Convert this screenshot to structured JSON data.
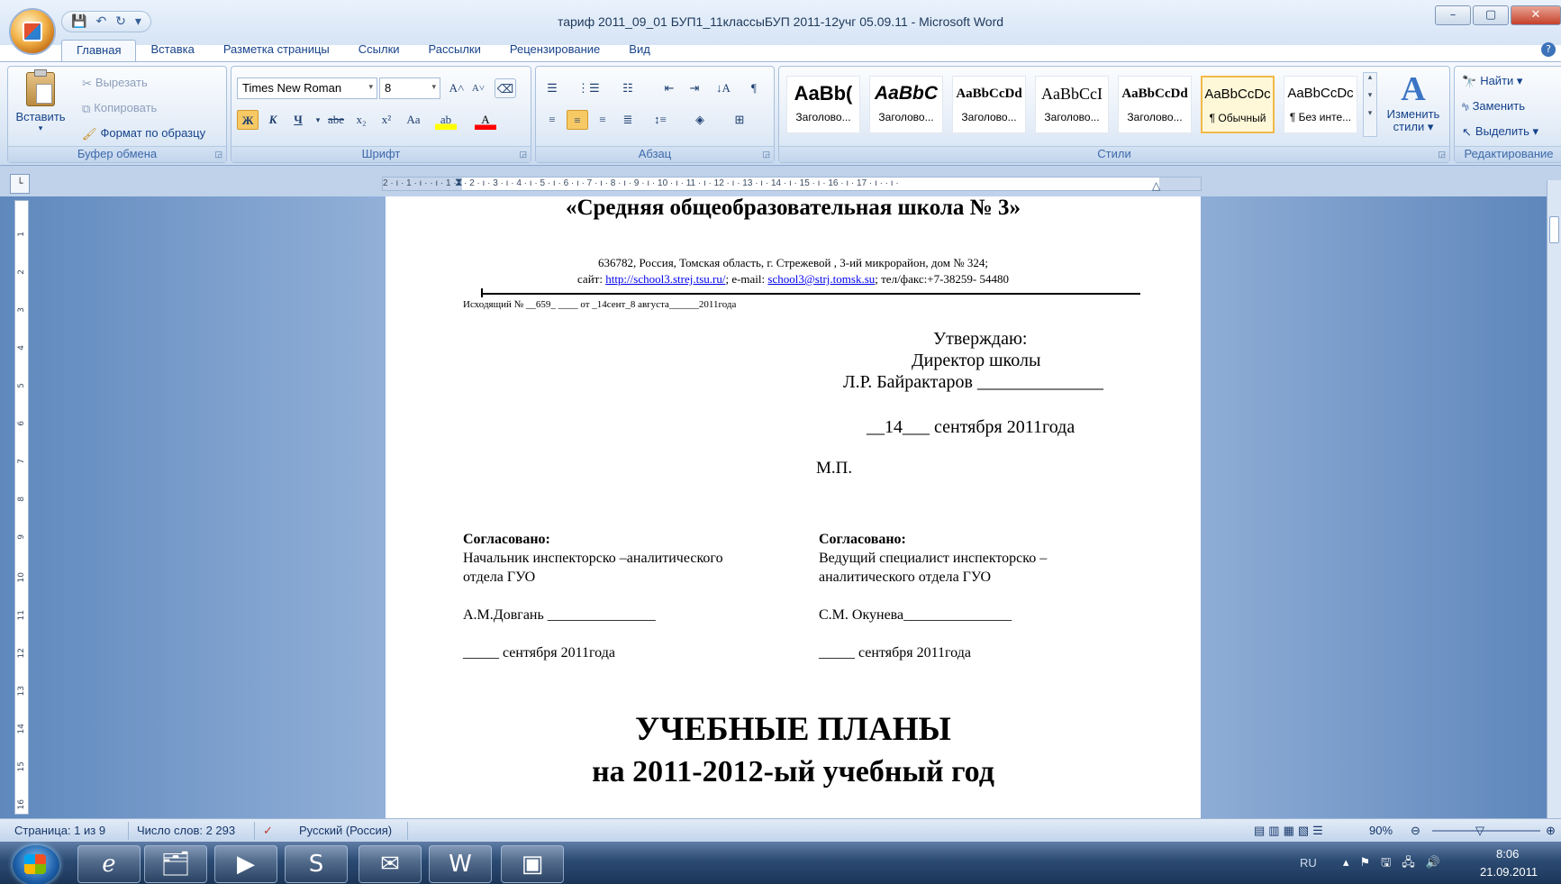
{
  "window": {
    "title": "тариф  2011_09_01 БУП1_11классыБУП 2011-12учг 05.09.11 - Microsoft Word"
  },
  "tabs": [
    "Главная",
    "Вставка",
    "Разметка страницы",
    "Ссылки",
    "Рассылки",
    "Рецензирование",
    "Вид"
  ],
  "clipboard": {
    "paste": "Вставить",
    "cut": "Вырезать",
    "copy": "Копировать",
    "format_painter": "Формат по образцу",
    "label": "Буфер обмена"
  },
  "font": {
    "name": "Times New Roman",
    "size": "8",
    "label": "Шрифт",
    "buttons": [
      "Ж",
      "К",
      "Ч",
      "abe",
      "x₂",
      "x²",
      "Aa"
    ]
  },
  "paragraph": {
    "label": "Абзац"
  },
  "styles": {
    "label": "Стили",
    "change_styles": "Изменить стили",
    "items": [
      {
        "preview": "AaBb(",
        "name": "Заголово..."
      },
      {
        "preview": "AaBbC",
        "name": "Заголово..."
      },
      {
        "preview": "AaBbCcDd",
        "name": "Заголово..."
      },
      {
        "preview": "AaBbCcI",
        "name": "Заголово..."
      },
      {
        "preview": "AaBbCcDd",
        "name": "Заголово..."
      },
      {
        "preview": "AaBbCcDc",
        "name": "¶ Обычный"
      },
      {
        "preview": "AaBbCcDc",
        "name": "¶ Без инте..."
      }
    ]
  },
  "editing": {
    "label": "Редактирование",
    "find": "Найти",
    "replace": "Заменить",
    "select": "Выделить"
  },
  "document": {
    "school": "«Средняя общеобразовательная школа № 3»",
    "address": "636782, Россия, Томская область, г. Стрежевой , 3-ий микрорайон, дом № 324;",
    "site_label": "сайт:",
    "site_url": "http://school3.strej.tsu.ru/",
    "email_label": "; e-mail:",
    "email": "school3@strj.tomsk.su",
    "phone": "; тел/факс:+7-38259- 54480",
    "outgoing": "Исходящий № __659_ ____ от _14сент_8 августа______2011года",
    "approve": "Утверждаю:",
    "director": "Директор  школы",
    "director_name": "Л.Р. Байрактаров ______________",
    "approve_date": "__14___ сентября 2011года",
    "stamp": "М.П.",
    "agreed_left_title": "Согласовано:",
    "agreed_left_l1": "Начальник инспекторско –аналитического",
    "agreed_left_l2": "отдела  ГУО",
    "agreed_left_name": "А.М.Довгань _______________",
    "agreed_left_date": "_____ сентября  2011года",
    "agreed_right_title": "Согласовано:",
    "agreed_right_l1": "Ведущий специалист  инспекторско –",
    "agreed_right_l2": "аналитического  отдела  ГУО",
    "agreed_right_name": "С.М. Окунева_______________",
    "agreed_right_date": "_____ сентября  2011года",
    "heading1": "УЧЕБНЫЕ ПЛАНЫ",
    "heading2": "на 2011-2012-ый учебный год"
  },
  "ruler": {
    "h_ticks": "2 · ı · 1 · ı ·   · ı · 1 · ı · 2 · ı · 3 · ı · 4 · ı · 5 · ı · 6 · ı · 7 · ı · 8 · ı · 9 · ı · 10 · ı · 11 · ı · 12 · ı · 13 · ı · 14 · ı · 15 · ı · 16 · ı · 17 · ı ·   · ı ·",
    "v_ticks": [
      "1",
      "2",
      "3",
      "4",
      "5",
      "6",
      "7",
      "8",
      "9",
      "10",
      "11",
      "12",
      "13",
      "14",
      "15",
      "16"
    ]
  },
  "status": {
    "page": "Страница: 1 из 9",
    "words": "Число слов: 2 293",
    "lang": "Русский (Россия)",
    "zoom": "90%"
  },
  "tray": {
    "lang": "RU",
    "time": "8:06",
    "date": "21.09.2011"
  },
  "colors": {
    "ribbon_text": "#15428b",
    "link": "#0000ee",
    "selected_style_border": "#f2b94a"
  }
}
